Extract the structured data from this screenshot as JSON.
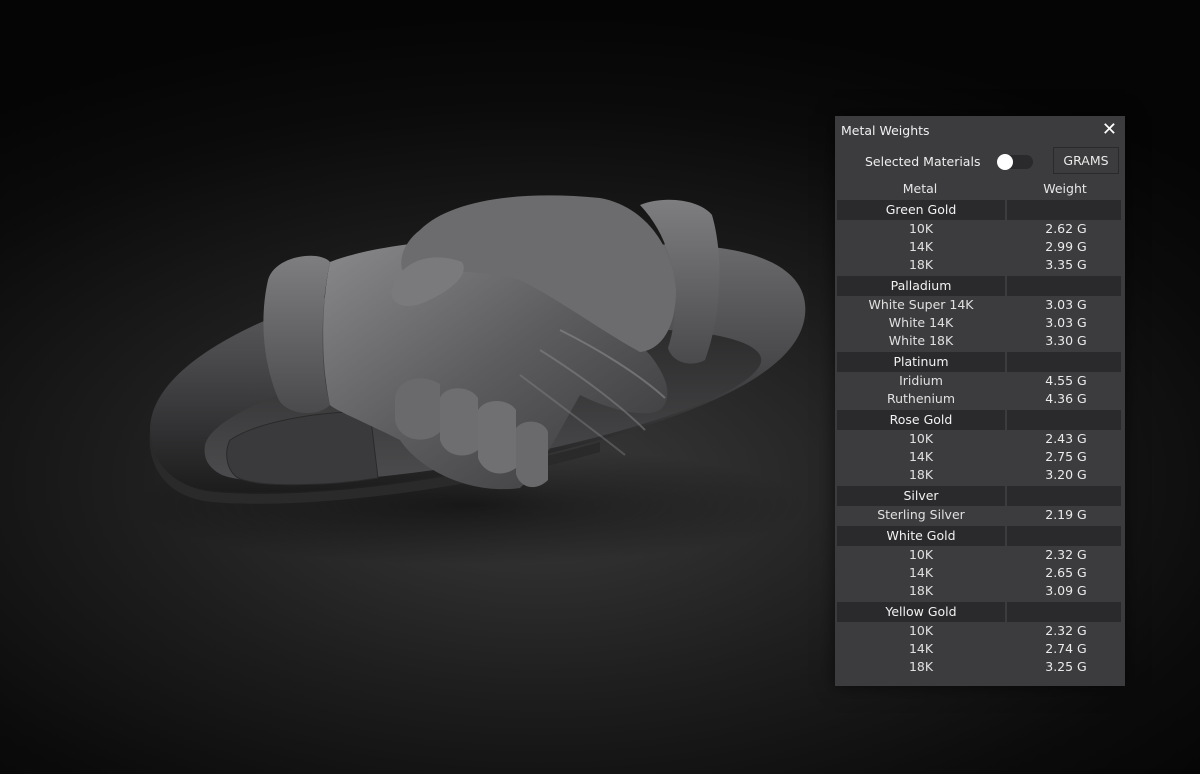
{
  "panel": {
    "title": "Metal Weights",
    "close_label": "✕",
    "selected_materials_label": "Selected Materials",
    "toggle_on": false,
    "unit_button_label": "GRAMS",
    "col_metal": "Metal",
    "col_weight": "Weight"
  },
  "groups": [
    {
      "name": "Green Gold",
      "items": [
        {
          "name": "10K",
          "weight": "2.62 G"
        },
        {
          "name": "14K",
          "weight": "2.99 G"
        },
        {
          "name": "18K",
          "weight": "3.35 G"
        }
      ]
    },
    {
      "name": "Palladium",
      "items": [
        {
          "name": "White Super 14K",
          "weight": "3.03 G"
        },
        {
          "name": "White 14K",
          "weight": "3.03 G"
        },
        {
          "name": "White 18K",
          "weight": "3.30 G"
        }
      ]
    },
    {
      "name": "Platinum",
      "items": [
        {
          "name": "Iridium",
          "weight": "4.55 G"
        },
        {
          "name": "Ruthenium",
          "weight": "4.36 G"
        }
      ]
    },
    {
      "name": "Rose Gold",
      "items": [
        {
          "name": "10K",
          "weight": "2.43 G"
        },
        {
          "name": "14K",
          "weight": "2.75 G"
        },
        {
          "name": "18K",
          "weight": "3.20 G"
        }
      ]
    },
    {
      "name": "Silver",
      "items": [
        {
          "name": "Sterling Silver",
          "weight": "2.19 G"
        }
      ]
    },
    {
      "name": "White Gold",
      "items": [
        {
          "name": "10K",
          "weight": "2.32 G"
        },
        {
          "name": "14K",
          "weight": "2.65 G"
        },
        {
          "name": "18K",
          "weight": "3.09 G"
        }
      ]
    },
    {
      "name": "Yellow Gold",
      "items": [
        {
          "name": "10K",
          "weight": "2.32 G"
        },
        {
          "name": "14K",
          "weight": "2.74 G"
        },
        {
          "name": "18K",
          "weight": "3.25 G"
        }
      ]
    }
  ]
}
